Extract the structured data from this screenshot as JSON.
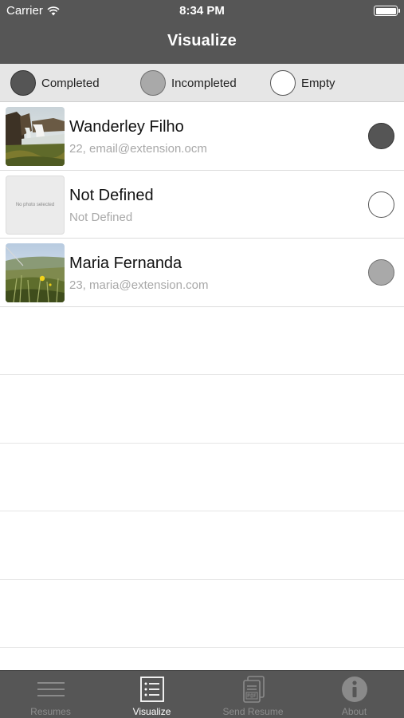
{
  "status_bar": {
    "carrier": "Carrier",
    "time": "8:34 PM"
  },
  "nav": {
    "title": "Visualize"
  },
  "legend": {
    "completed": "Completed",
    "incompleted": "Incompleted",
    "empty": "Empty"
  },
  "colors": {
    "header_bg": "#565656",
    "completed": "#555555",
    "incompleted": "#a9a9a9",
    "empty": "#ffffff"
  },
  "rows": [
    {
      "name": "Wanderley Filho",
      "detail": "22, email@extension.ocm",
      "status": "completed",
      "photo": "waterfall-photo"
    },
    {
      "name": "Not Defined",
      "detail": "Not Defined",
      "status": "empty",
      "photo": "no-photo",
      "photo_text": "No photo selected"
    },
    {
      "name": "Maria Fernanda",
      "detail": "23, maria@extension.com",
      "status": "incompleted",
      "photo": "meadow-photo"
    }
  ],
  "tabs": [
    {
      "label": "Resumes",
      "icon": "list-lines-icon",
      "active": false
    },
    {
      "label": "Visualize",
      "icon": "checklist-icon",
      "active": true
    },
    {
      "label": "Send Resume",
      "icon": "pdf-document-icon",
      "active": false
    },
    {
      "label": "About",
      "icon": "info-icon",
      "active": false
    }
  ]
}
